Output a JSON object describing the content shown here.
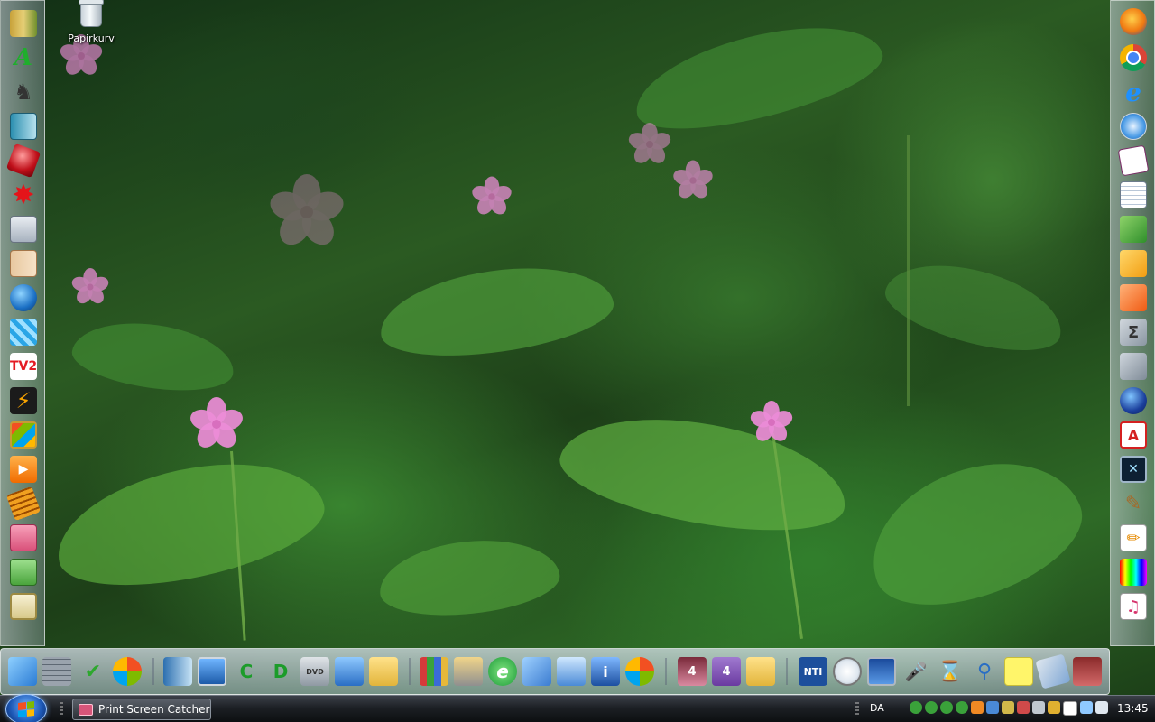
{
  "desktop": {
    "icons": [
      {
        "label": "Papirkurv",
        "icon": "recycle-bin-icon"
      }
    ]
  },
  "left_dock": {
    "icons": [
      "folder-books-icon",
      "green-script-icon",
      "chess-icon",
      "notebook-icon",
      "red-gem-icon",
      "red-splat-icon",
      "calculator-icon",
      "scroll-icon",
      "network-globe-icon",
      "blue-cubes-icon",
      "tv2-icon",
      "lightning-icon",
      "windows-window-icon",
      "media-player-icon",
      "film-strip-icon",
      "pink-camera-icon",
      "green-camera-icon",
      "clipboard-icon"
    ]
  },
  "right_dock": {
    "icons": [
      "firefox-icon",
      "chrome-icon",
      "internet-explorer-icon",
      "safari-icon",
      "word-pad-icon",
      "document-icon",
      "spreadsheet-icon",
      "drawing-icon",
      "presentation-icon",
      "formula-icon",
      "text-document-icon",
      "globe-icon",
      "pdf-icon",
      "terminal-icon",
      "brush-icon",
      "pencil-icon",
      "color-palette-icon",
      "music-file-icon"
    ]
  },
  "launch_bar": {
    "icons": [
      "vista-start-icon",
      "firewall-icon",
      "security-check-icon",
      "windows-media-icon",
      "document-viewer-icon",
      "computer-icon",
      "drive-c-icon",
      "drive-d-icon",
      "dvd-drive-icon",
      "network-icon",
      "folder-icon",
      "archive-icon",
      "scanner-icon",
      "edge-icon",
      "control-panel-icon",
      "network-share-icon",
      "system-info-icon",
      "windows-update-icon",
      "record-icon",
      "app-4-icon",
      "folder-icon",
      "nti-backup-icon",
      "clock-icon",
      "monitor-icon",
      "microphone-icon",
      "hourglass-icon",
      "magnifier-icon",
      "sticky-note-icon",
      "tablet-icon",
      "calculator-panel-icon"
    ],
    "badges": {
      "record": "4",
      "app4": "4",
      "nti": "NTI"
    }
  },
  "taskbar": {
    "start_label": "Start",
    "tasks": [
      {
        "label": "Print Screen Catcher",
        "active": true
      }
    ],
    "language": "DA",
    "clock": "13:45"
  }
}
